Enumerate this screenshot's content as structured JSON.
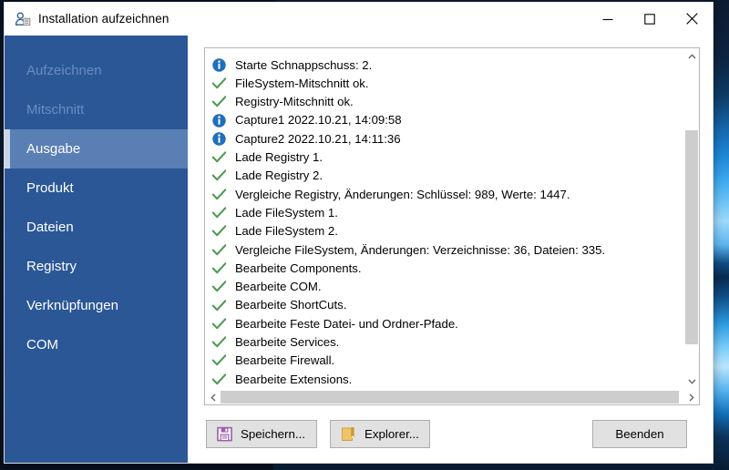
{
  "window": {
    "title": "Installation aufzeichnen",
    "icon": "user-record-icon",
    "controls": {
      "minimize": "minimize-button",
      "maximize": "maximize-button",
      "close": "close-button"
    }
  },
  "sidebar": {
    "items": [
      {
        "label": "Aufzeichnen",
        "state": "disabled"
      },
      {
        "label": "Mitschnitt",
        "state": "disabled"
      },
      {
        "label": "Ausgabe",
        "state": "selected"
      },
      {
        "label": "Produkt",
        "state": "normal"
      },
      {
        "label": "Dateien",
        "state": "normal"
      },
      {
        "label": "Registry",
        "state": "normal"
      },
      {
        "label": "Verknüpfungen",
        "state": "normal"
      },
      {
        "label": "COM",
        "state": "normal"
      }
    ]
  },
  "log": {
    "rows": [
      {
        "icon": "info-icon",
        "text": "Starte Schnappschuss: 2."
      },
      {
        "icon": "check-icon",
        "text": "FileSystem-Mitschnitt ok."
      },
      {
        "icon": "check-icon",
        "text": "Registry-Mitschnitt ok."
      },
      {
        "icon": "info-icon",
        "text": "Capture1 2022.10.21, 14:09:58"
      },
      {
        "icon": "info-icon",
        "text": "Capture2 2022.10.21, 14:11:36"
      },
      {
        "icon": "check-icon",
        "text": "Lade Registry 1."
      },
      {
        "icon": "check-icon",
        "text": "Lade Registry 2."
      },
      {
        "icon": "check-icon",
        "text": "Vergleiche Registry, Änderungen: Schlüssel: 989, Werte: 1447."
      },
      {
        "icon": "check-icon",
        "text": "Lade FileSystem 1."
      },
      {
        "icon": "check-icon",
        "text": "Lade FileSystem 2."
      },
      {
        "icon": "check-icon",
        "text": "Vergleiche FileSystem, Änderungen: Verzeichnisse: 36, Dateien: 335."
      },
      {
        "icon": "check-icon",
        "text": "Bearbeite Components."
      },
      {
        "icon": "check-icon",
        "text": "Bearbeite COM."
      },
      {
        "icon": "check-icon",
        "text": "Bearbeite ShortCuts."
      },
      {
        "icon": "check-icon",
        "text": "Bearbeite Feste Datei- und Ordner-Pfade."
      },
      {
        "icon": "check-icon",
        "text": "Bearbeite Services."
      },
      {
        "icon": "check-icon",
        "text": "Bearbeite Firewall."
      },
      {
        "icon": "check-icon",
        "text": "Bearbeite Extensions."
      },
      {
        "icon": "info-icon",
        "text": ""
      }
    ]
  },
  "scrollbars": {
    "vertical": {
      "up": "scroll-up-arrow",
      "down": "scroll-down-arrow"
    },
    "horizontal": {
      "left": "scroll-left-arrow",
      "right": "scroll-right-arrow"
    }
  },
  "buttons": {
    "save": {
      "label": "Speichern...",
      "icon": "floppy-disk-icon"
    },
    "explorer": {
      "label": "Explorer...",
      "icon": "folder-icon"
    },
    "quit": {
      "label": "Beenden"
    }
  },
  "colors": {
    "sidebar": "#2b5797",
    "sidebar_selected": "#5a7fb5",
    "sidebar_disabled_text": "#6a8cc0",
    "check_green": "#4e9a52",
    "info_blue": "#1f6fbd",
    "save_icon_purple": "#9b5fa8",
    "folder_icon_orange": "#e6b84f",
    "button_face": "#e1e1e1"
  }
}
